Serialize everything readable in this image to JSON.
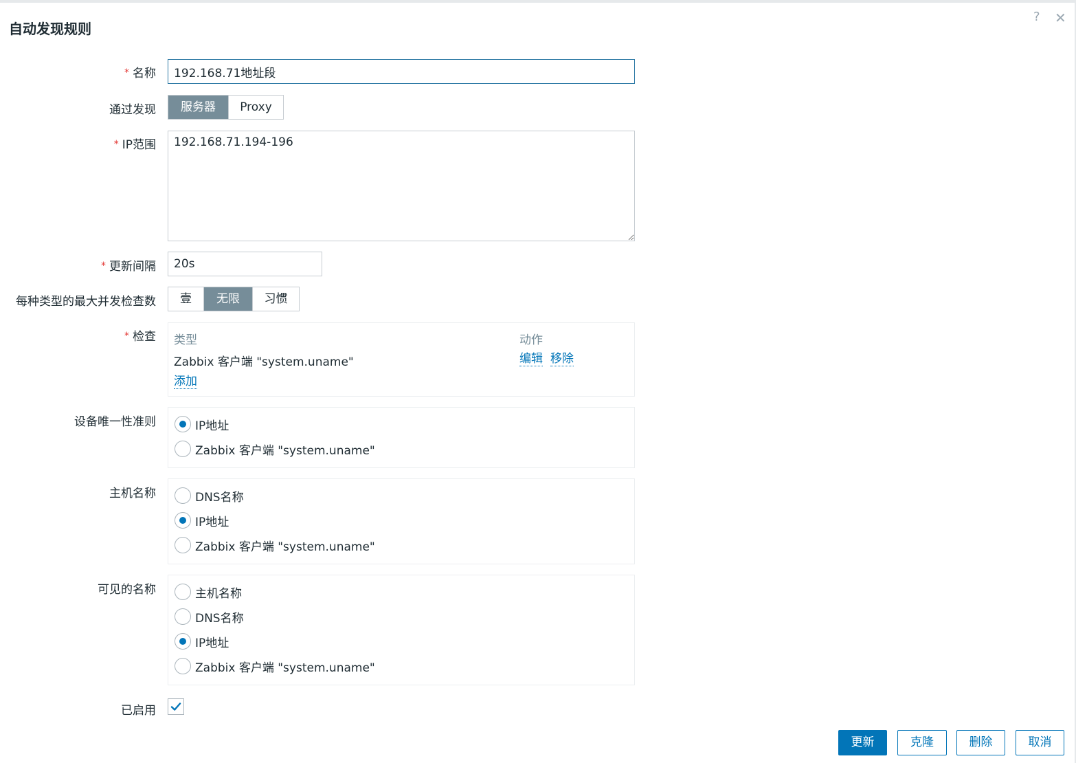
{
  "dialog": {
    "title": "自动发现规则",
    "help_icon": "?",
    "close_icon": "✕"
  },
  "form": {
    "name": {
      "label": "名称",
      "value": "192.168.71地址段"
    },
    "discovery_by": {
      "label": "通过发现",
      "options": [
        "服务器",
        "Proxy"
      ],
      "selected": "服务器"
    },
    "ip_range": {
      "label": "IP范围",
      "value": "192.168.71.194-196"
    },
    "update_interval": {
      "label": "更新间隔",
      "value": "20s"
    },
    "max_concurrent": {
      "label": "每种类型的最大并发检查数",
      "options": [
        "壹",
        "无限",
        "习惯"
      ],
      "selected": "无限"
    },
    "checks": {
      "label": "检查",
      "col_type": "类型",
      "col_action": "动作",
      "rows": [
        {
          "type": "Zabbix 客户端 \"system.uname\"",
          "edit": "编辑",
          "remove": "移除"
        }
      ],
      "add": "添加"
    },
    "uniqueness": {
      "label": "设备唯一性准则",
      "options": [
        "IP地址",
        "Zabbix 客户端 \"system.uname\""
      ],
      "selected": "IP地址"
    },
    "host_name": {
      "label": "主机名称",
      "options": [
        "DNS名称",
        "IP地址",
        "Zabbix 客户端 \"system.uname\""
      ],
      "selected": "IP地址"
    },
    "visible_name": {
      "label": "可见的名称",
      "options": [
        "主机名称",
        "DNS名称",
        "IP地址",
        "Zabbix 客户端 \"system.uname\""
      ],
      "selected": "IP地址"
    },
    "enabled": {
      "label": "已启用",
      "checked": true
    }
  },
  "buttons": {
    "update": "更新",
    "clone": "克隆",
    "delete": "删除",
    "cancel": "取消"
  },
  "colors": {
    "accent": "#0275b8",
    "required": "#e33734",
    "segment_selected": "#768d99"
  }
}
